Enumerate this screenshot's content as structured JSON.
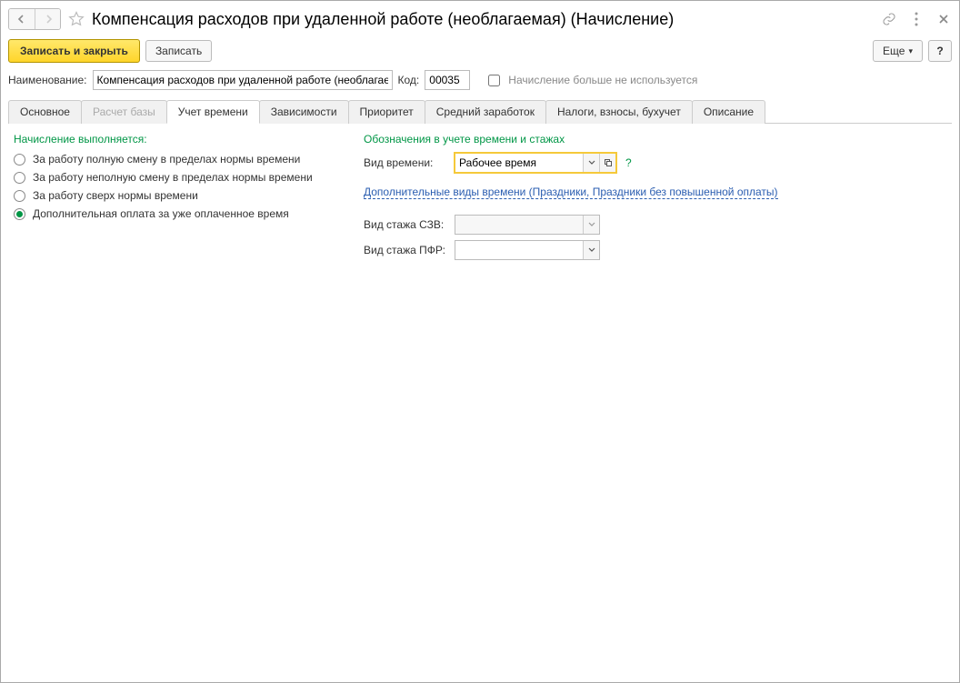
{
  "header": {
    "title": "Компенсация расходов при удаленной работе (необлагаемая) (Начисление)"
  },
  "toolbar": {
    "save_close": "Записать и закрыть",
    "save": "Записать",
    "more": "Еще",
    "help": "?"
  },
  "nameRow": {
    "name_label": "Наименование:",
    "name_value": "Компенсация расходов при удаленной работе (необлагаемая",
    "code_label": "Код:",
    "code_value": "00035",
    "unused_label": "Начисление больше не используется",
    "unused_checked": false
  },
  "tabs": [
    {
      "id": "main",
      "label": "Основное",
      "active": false,
      "disabled": false
    },
    {
      "id": "base",
      "label": "Расчет базы",
      "active": false,
      "disabled": true
    },
    {
      "id": "time",
      "label": "Учет времени",
      "active": true,
      "disabled": false
    },
    {
      "id": "dep",
      "label": "Зависимости",
      "active": false,
      "disabled": false
    },
    {
      "id": "prio",
      "label": "Приоритет",
      "active": false,
      "disabled": false
    },
    {
      "id": "avg",
      "label": "Средний заработок",
      "active": false,
      "disabled": false
    },
    {
      "id": "tax",
      "label": "Налоги, взносы, бухучет",
      "active": false,
      "disabled": false
    },
    {
      "id": "desc",
      "label": "Описание",
      "active": false,
      "disabled": false
    }
  ],
  "left": {
    "section": "Начисление выполняется:",
    "options": [
      {
        "label": "За работу полную смену в пределах нормы времени",
        "checked": false
      },
      {
        "label": "За работу неполную смену в пределах нормы времени",
        "checked": false
      },
      {
        "label": "За работу сверх нормы времени",
        "checked": false
      },
      {
        "label": "Дополнительная оплата за уже оплаченное время",
        "checked": true
      }
    ]
  },
  "right": {
    "section": "Обозначения в учете времени и стажах",
    "time_type_label": "Вид времени:",
    "time_type_value": "Рабочее время",
    "additional_link": "Дополнительные виды времени (Праздники, Праздники без повышенной оплаты)",
    "szv_label": "Вид стажа СЗВ:",
    "szv_value": "",
    "pfr_label": "Вид стажа ПФР:",
    "pfr_value": ""
  },
  "help_hint": "?"
}
